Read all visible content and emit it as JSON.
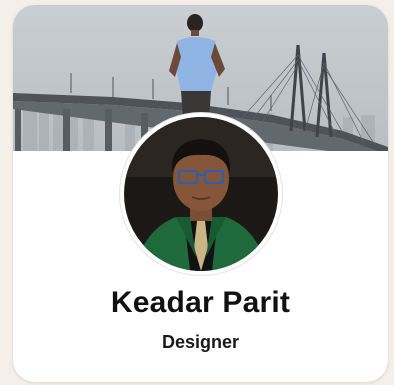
{
  "profile": {
    "name": "Keadar Parit",
    "role": "Designer"
  },
  "images": {
    "cover": "cover-photo-bridge-skyline",
    "avatar": "profile-photo-person-green-blazer"
  },
  "colors": {
    "page_background": "#f5efe9",
    "card_background": "#ffffff",
    "name_text": "#111111",
    "role_text": "#1a1a1a"
  }
}
